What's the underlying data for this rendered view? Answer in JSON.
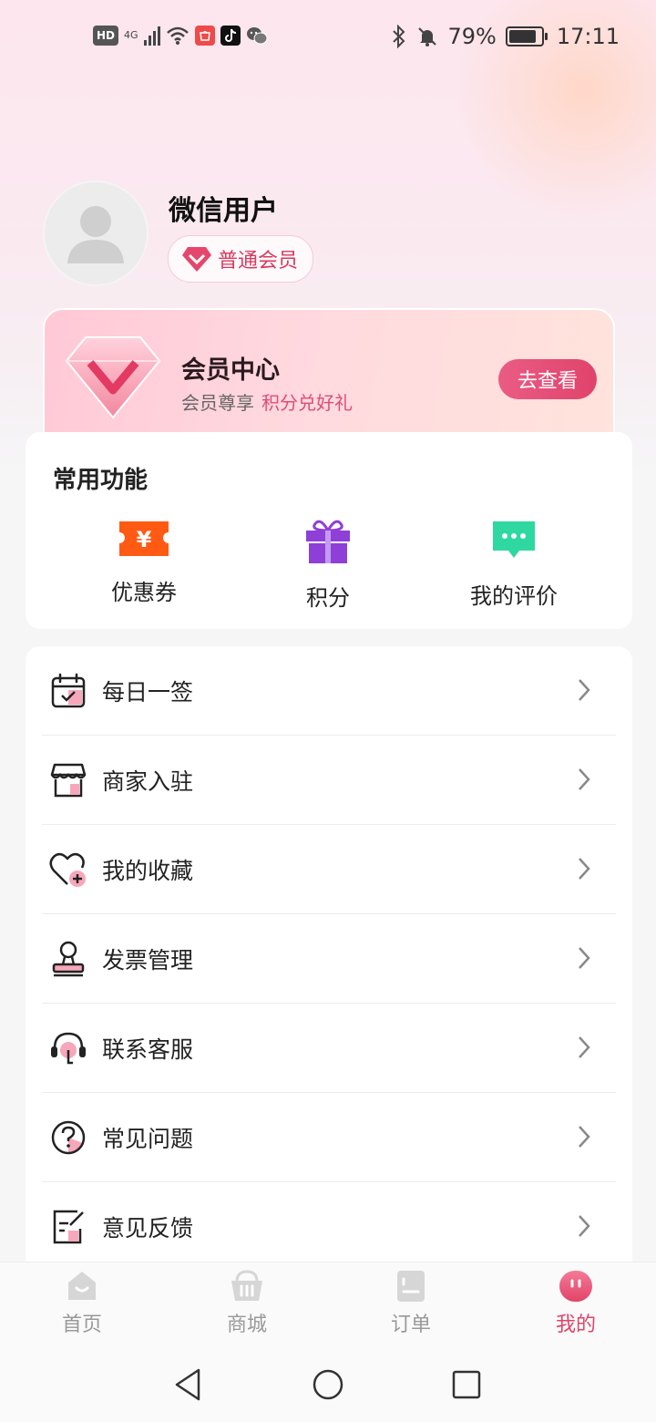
{
  "status_bar": {
    "hd": "HD",
    "network": "4G",
    "battery_percent": "79%",
    "time": "17:11",
    "icons": [
      "hd-icon",
      "signal-icon",
      "wifi-icon",
      "huawei-app-icon",
      "tiktok-icon",
      "wechat-icon",
      "bluetooth-icon",
      "mute-icon",
      "battery-icon"
    ]
  },
  "profile": {
    "username": "微信用户",
    "member_level": "普通会员"
  },
  "vip_card": {
    "title": "会员中心",
    "subtitle": "会员尊享",
    "highlight": "积分兑好礼",
    "button": "去查看"
  },
  "common_functions": {
    "title": "常用功能",
    "items": [
      {
        "label": "优惠券",
        "icon": "coupon-icon",
        "color": "#ff5a14"
      },
      {
        "label": "积分",
        "icon": "gift-icon",
        "color": "#8e3fd8"
      },
      {
        "label": "我的评价",
        "icon": "comment-icon",
        "color": "#2ed8a0"
      }
    ]
  },
  "menu": {
    "items": [
      {
        "label": "每日一签",
        "icon": "calendar-check-icon"
      },
      {
        "label": "商家入驻",
        "icon": "store-icon"
      },
      {
        "label": "我的收藏",
        "icon": "heart-add-icon"
      },
      {
        "label": "发票管理",
        "icon": "stamp-icon"
      },
      {
        "label": "联系客服",
        "icon": "headset-icon"
      },
      {
        "label": "常见问题",
        "icon": "question-icon"
      },
      {
        "label": "意见反馈",
        "icon": "feedback-icon"
      }
    ]
  },
  "tabbar": {
    "items": [
      {
        "label": "首页",
        "icon": "home-icon"
      },
      {
        "label": "商城",
        "icon": "basket-icon"
      },
      {
        "label": "订单",
        "icon": "order-icon"
      },
      {
        "label": "我的",
        "icon": "profile-face-icon",
        "active": true
      }
    ]
  },
  "colors": {
    "accent": "#e14469",
    "accent_light": "#f6c9d6"
  }
}
